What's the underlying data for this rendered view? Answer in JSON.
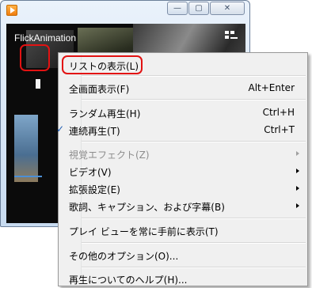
{
  "window": {
    "video_title": "FlickAnimation",
    "caption_buttons": {
      "minimize": "—",
      "maximize": "▢",
      "close": "✕"
    }
  },
  "menu": {
    "items": [
      {
        "label": "リストの表示(L)",
        "shortcut": "",
        "submenu": false,
        "checked": false,
        "disabled": false
      },
      {
        "label": "全画面表示(F)",
        "shortcut": "Alt+Enter",
        "submenu": false,
        "checked": false,
        "disabled": false
      },
      {
        "label": "ランダム再生(H)",
        "shortcut": "Ctrl+H",
        "submenu": false,
        "checked": false,
        "disabled": false
      },
      {
        "label": "連続再生(T)",
        "shortcut": "Ctrl+T",
        "submenu": false,
        "checked": true,
        "disabled": false
      },
      {
        "label": "視覚エフェクト(Z)",
        "shortcut": "",
        "submenu": true,
        "checked": false,
        "disabled": true
      },
      {
        "label": "ビデオ(V)",
        "shortcut": "",
        "submenu": true,
        "checked": false,
        "disabled": false
      },
      {
        "label": "拡張設定(E)",
        "shortcut": "",
        "submenu": true,
        "checked": false,
        "disabled": false
      },
      {
        "label": "歌詞、キャプション、および字幕(B)",
        "shortcut": "",
        "submenu": true,
        "checked": false,
        "disabled": false
      },
      {
        "label": "プレイ ビューを常に手前に表示(T)",
        "shortcut": "",
        "submenu": false,
        "checked": false,
        "disabled": false
      },
      {
        "label": "その他のオプション(O)...",
        "shortcut": "",
        "submenu": false,
        "checked": false,
        "disabled": false
      },
      {
        "label": "再生についてのヘルプ(H)...",
        "shortcut": "",
        "submenu": false,
        "checked": false,
        "disabled": false
      }
    ],
    "check_mark": "✓"
  },
  "colors": {
    "highlight_box": "#e21212",
    "check": "#1e5cb3",
    "menu_background": "#f0f0f0"
  }
}
